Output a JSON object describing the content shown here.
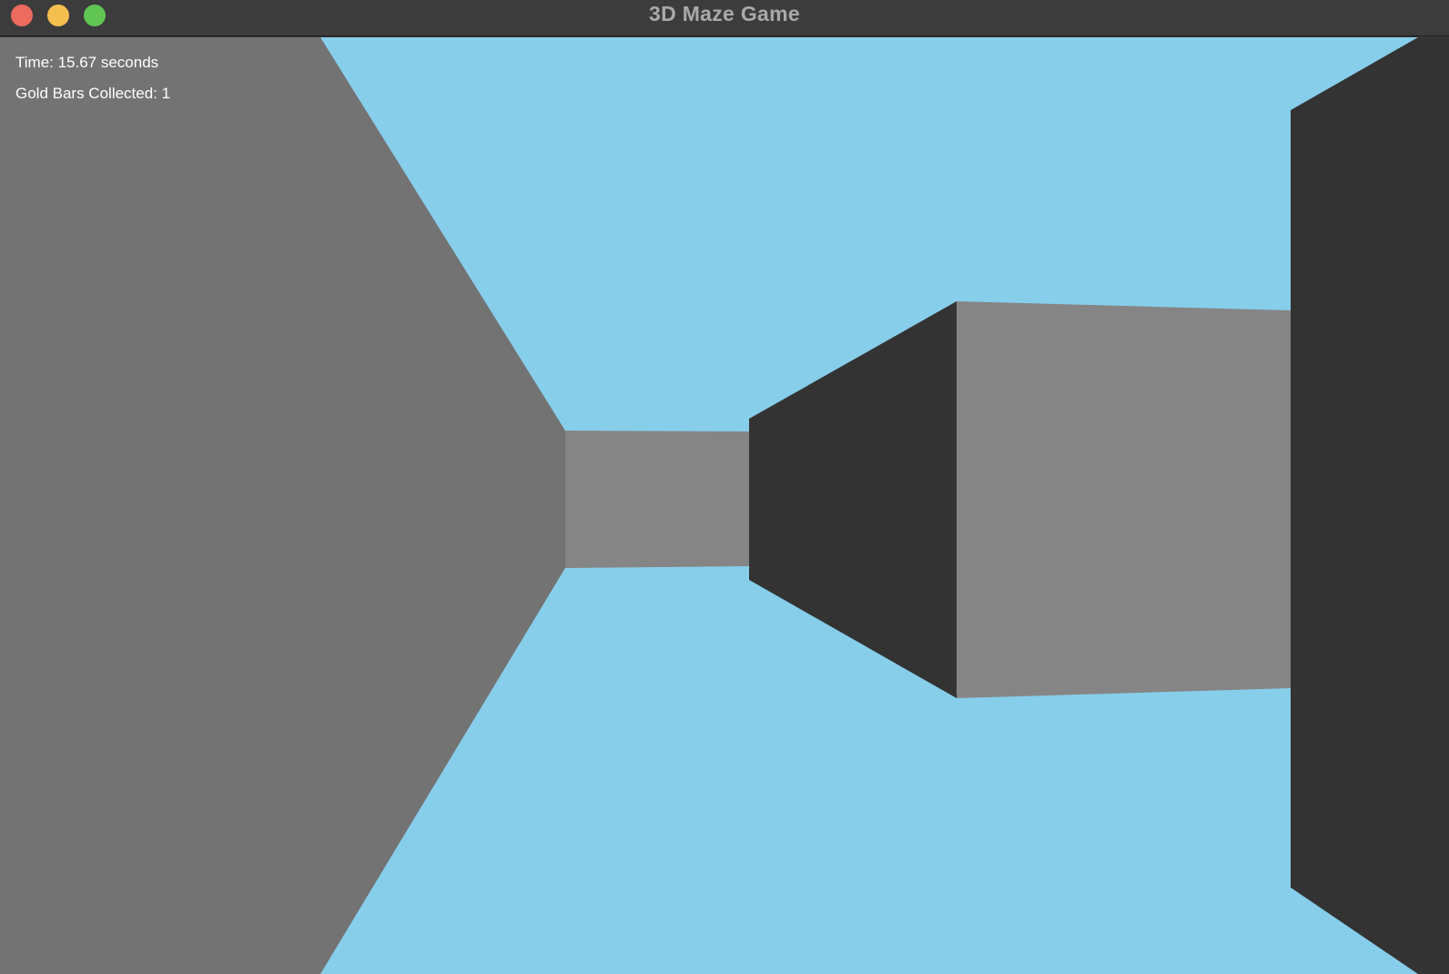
{
  "window": {
    "title": "3D Maze Game",
    "controls": {
      "close_color": "#ec6a5e",
      "minimize_color": "#f4bf4f",
      "zoom_color": "#61c554"
    }
  },
  "hud": {
    "time_text": "Time: 15.67 seconds",
    "gold_text": "Gold Bars Collected: 1"
  },
  "scene": {
    "colors": {
      "sky": "#87ceeb",
      "floor": "#87ceeb",
      "wall_side_light": "#737373",
      "wall_front": "#858585",
      "wall_side_dark": "#333333"
    }
  }
}
